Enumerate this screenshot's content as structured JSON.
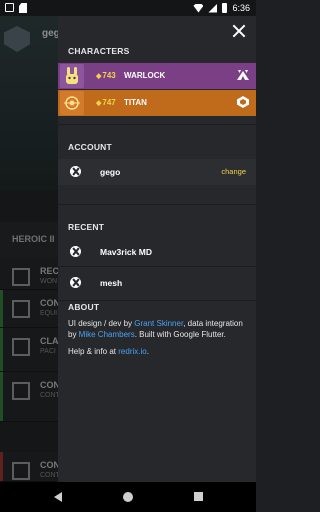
{
  "status_bar": {
    "time": "6:36"
  },
  "background": {
    "header_name": "gego",
    "tab_label": "HEROIC II",
    "rows": [
      {
        "title": "RECENT",
        "sub": "WON"
      },
      {
        "title": "CON",
        "sub": "EQUI"
      },
      {
        "title": "CLA",
        "sub": "PACI"
      },
      {
        "title": "CON",
        "sub": "CONT"
      },
      {
        "title": "CON",
        "sub": "CONT"
      }
    ]
  },
  "drawer": {
    "sections": {
      "characters": "CHARACTERS",
      "account": "ACCOUNT",
      "recent": "RECENT",
      "about": "ABOUT"
    },
    "characters": [
      {
        "light": "743",
        "class": "WARLOCK",
        "color": "#7b3f86",
        "emblem_icon": "rabbit-emblem-icon",
        "class_icon": "warlock-icon"
      },
      {
        "light": "747",
        "class": "TITAN",
        "color": "#c06a1c",
        "emblem_icon": "sun-emblem-icon",
        "class_icon": "titan-icon"
      }
    ],
    "account": {
      "name": "gego",
      "change_label": "change"
    },
    "recent": [
      {
        "name": "Mav3rick MD"
      },
      {
        "name": "mesh"
      }
    ],
    "about": {
      "t1": "UI design / dev by ",
      "l1": "Grant Skinner",
      "t2": ", data integration by ",
      "l2": "Mike Chambers",
      "t3": ". Built with Google Flutter.",
      "t4": "Help & info at ",
      "l3": "redrix.io",
      "t5": "."
    }
  },
  "colors": {
    "accent_yellow": "#f2d24a",
    "link_blue": "#4aa3f0"
  }
}
